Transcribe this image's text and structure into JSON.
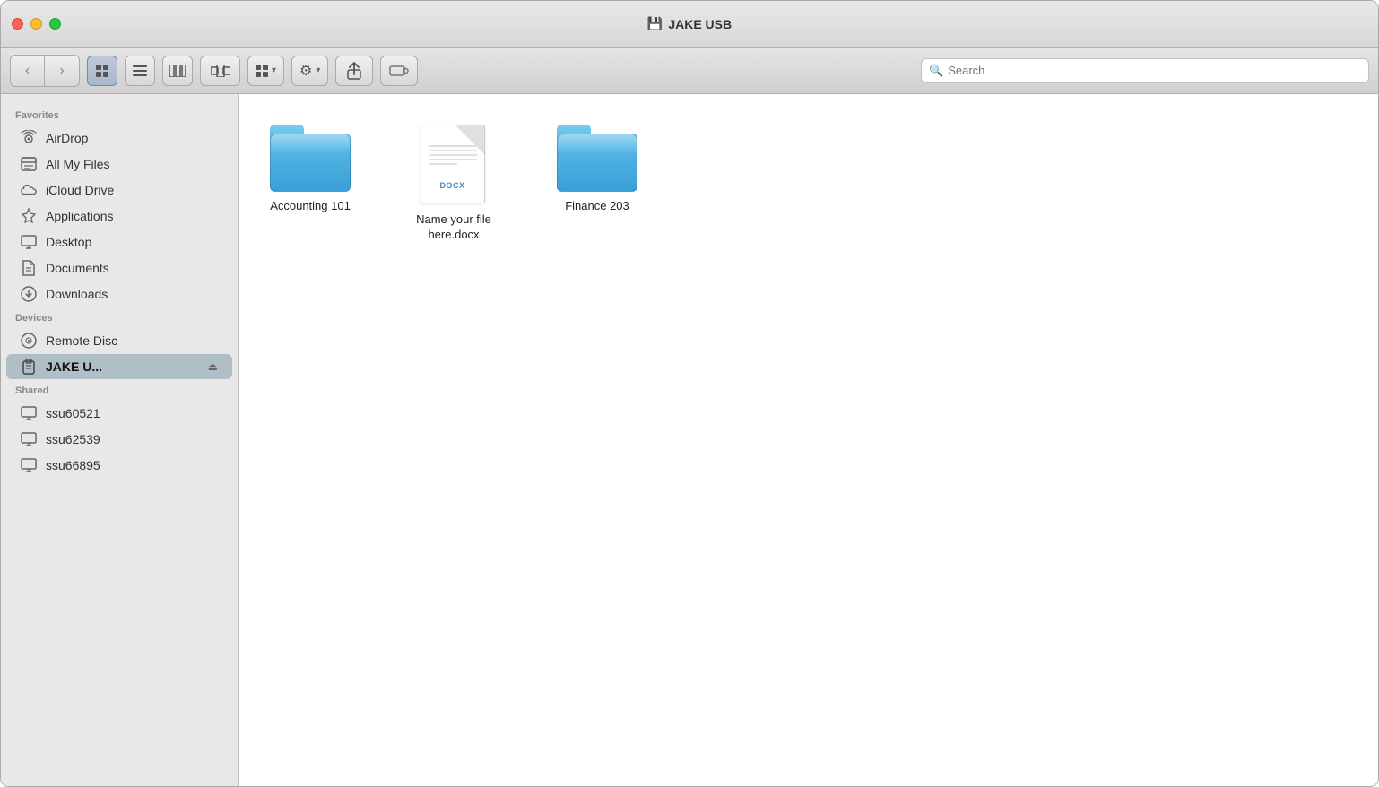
{
  "window": {
    "title": "JAKE USB",
    "title_icon": "💾"
  },
  "toolbar": {
    "back_label": "‹",
    "forward_label": "›",
    "view_icon_grid": "▦",
    "view_icon_list": "☰",
    "view_icon_column": "⊞",
    "view_icon_cover": "⊟",
    "arrange_label": "⊞",
    "arrange_arrow": "▾",
    "gear_label": "⚙",
    "gear_arrow": "▾",
    "share_label": "↑",
    "tag_label": "tag",
    "search_placeholder": "Search"
  },
  "sidebar": {
    "favorites_label": "Favorites",
    "devices_label": "Devices",
    "shared_label": "Shared",
    "items": [
      {
        "id": "airdrop",
        "label": "AirDrop",
        "icon": "📡"
      },
      {
        "id": "all-my-files",
        "label": "All My Files",
        "icon": "📋"
      },
      {
        "id": "icloud-drive",
        "label": "iCloud Drive",
        "icon": "☁"
      },
      {
        "id": "applications",
        "label": "Applications",
        "icon": "✦"
      },
      {
        "id": "desktop",
        "label": "Desktop",
        "icon": "🖥"
      },
      {
        "id": "documents",
        "label": "Documents",
        "icon": "📄"
      },
      {
        "id": "downloads",
        "label": "Downloads",
        "icon": "⬇"
      }
    ],
    "devices": [
      {
        "id": "remote-disc",
        "label": "Remote Disc",
        "icon": "💿"
      },
      {
        "id": "jake-usb",
        "label": "JAKE U...",
        "icon": "💾",
        "active": true
      }
    ],
    "shared": [
      {
        "id": "ssu60521",
        "label": "ssu60521",
        "icon": "🖥"
      },
      {
        "id": "ssu62539",
        "label": "ssu62539",
        "icon": "🖥"
      },
      {
        "id": "ssu66895",
        "label": "ssu66895",
        "icon": "🖥"
      }
    ]
  },
  "content": {
    "items": [
      {
        "id": "accounting-101",
        "type": "folder",
        "name": "Accounting 101"
      },
      {
        "id": "name-your-file",
        "type": "docx",
        "name": "Name your file here.docx",
        "ext": "DOCX"
      },
      {
        "id": "finance-203",
        "type": "folder",
        "name": "Finance 203"
      }
    ]
  }
}
